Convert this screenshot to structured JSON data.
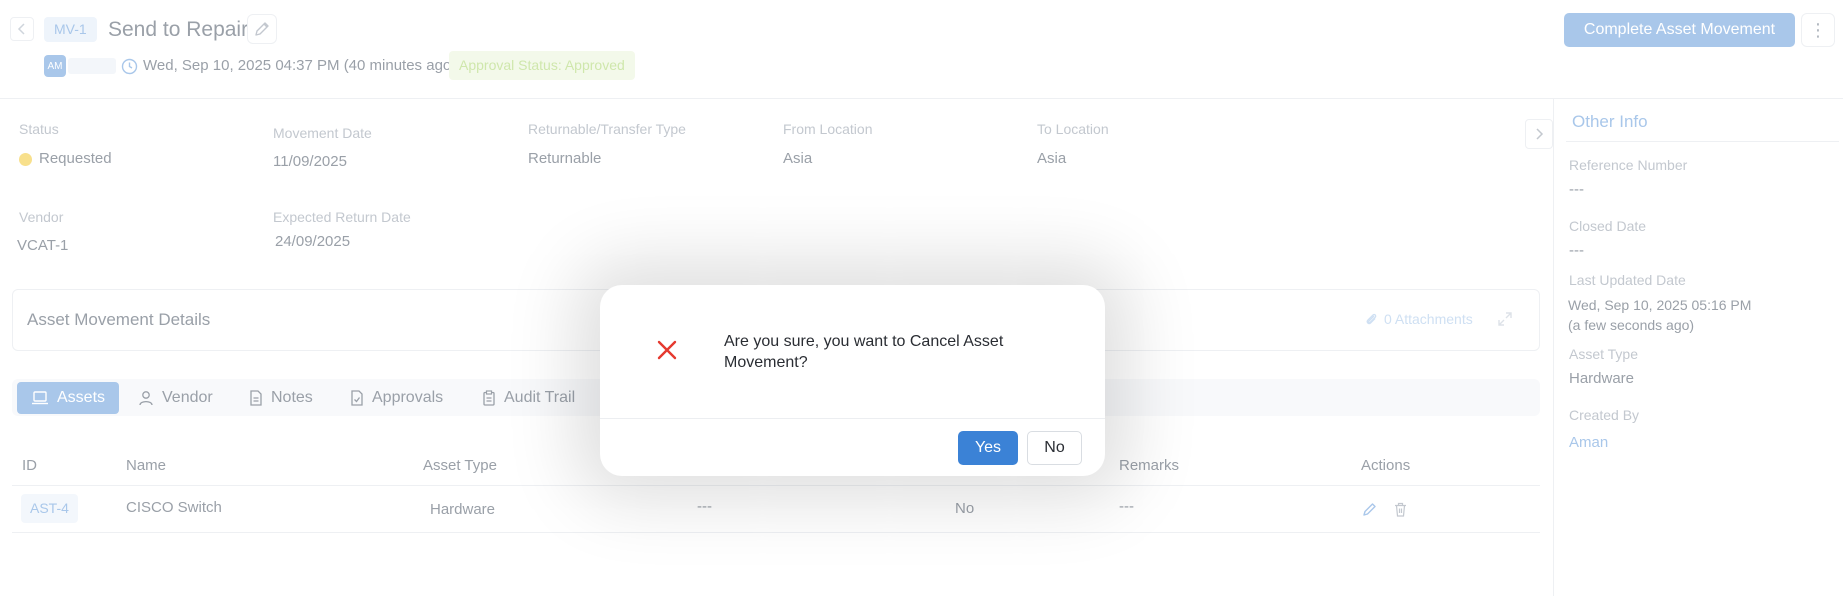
{
  "header": {
    "back_icon": "chevron-left-icon",
    "movement_id": "MV-1",
    "title": "Send to Repair",
    "avatar_initials": "AM",
    "created_time": "Wed, Sep 10, 2025 04:37 PM (40 minutes ago)",
    "approval_status": "Approval Status: Approved",
    "complete_button": "Complete Asset Movement",
    "more_icon": "⋮"
  },
  "details": {
    "status_label": "Status",
    "status_value": "Requested",
    "status_color": "#f8e08c",
    "movement_date_label": "Movement Date",
    "movement_date_value": "11/09/2025",
    "type_label": "Returnable/Transfer Type",
    "type_value": "Returnable",
    "from_label": "From Location",
    "from_value": "Asia",
    "to_label": "To Location",
    "to_value": "Asia",
    "vendor_label": "Vendor",
    "vendor_value": "VCAT-1",
    "return_date_label": "Expected Return Date",
    "return_date_value": "24/09/2025"
  },
  "sidebar": {
    "title": "Other Info",
    "reference_label": "Reference Number",
    "reference_value": "---",
    "closed_label": "Closed Date",
    "closed_value": "---",
    "updated_label": "Last Updated Date",
    "updated_value": "Wed, Sep 10, 2025 05:16 PM",
    "updated_relative": "(a few seconds ago)",
    "asset_type_label": "Asset Type",
    "asset_type_value": "Hardware",
    "created_by_label": "Created By",
    "created_by_value": "Aman"
  },
  "movement_details": {
    "title": "Asset Movement Details",
    "attachments": "0 Attachments"
  },
  "tabs": [
    {
      "label": "Assets",
      "icon": "laptop-icon",
      "active": true
    },
    {
      "label": "Vendor",
      "icon": "user-icon",
      "active": false
    },
    {
      "label": "Notes",
      "icon": "document-icon",
      "active": false
    },
    {
      "label": "Approvals",
      "icon": "file-check-icon",
      "active": false
    },
    {
      "label": "Audit Trail",
      "icon": "clipboard-icon",
      "active": false
    }
  ],
  "table": {
    "headers": {
      "id": "ID",
      "name": "Name",
      "asset_type": "Asset Type",
      "remarks": "Remarks",
      "actions": "Actions"
    },
    "rows": [
      {
        "id": "AST-4",
        "name": "CISCO Switch",
        "asset_type": "Hardware",
        "col4": "---",
        "col5": "No",
        "remarks": "---"
      }
    ]
  },
  "modal": {
    "message": "Are you sure, you want to Cancel Asset Movement?",
    "yes": "Yes",
    "no": "No",
    "icon": "close-x-icon",
    "icon_color": "#e5392f"
  },
  "colors": {
    "accent": "#3b82d6",
    "accent_faded": "#a9c7ea"
  }
}
